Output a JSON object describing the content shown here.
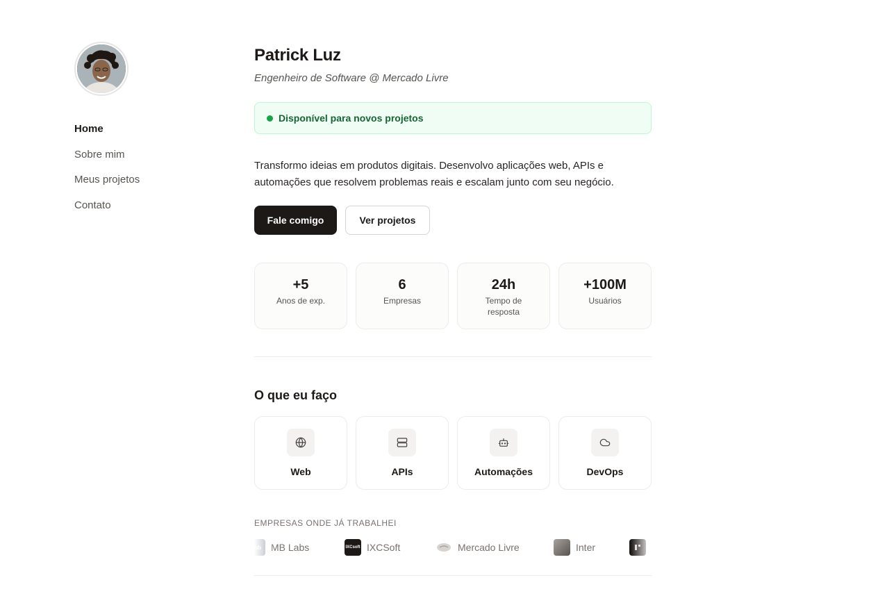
{
  "profile": {
    "name": "Patrick Luz",
    "role": "Engenheiro de Software @ Mercado Livre",
    "avatar_icon": "profile-photo"
  },
  "nav": {
    "items": [
      {
        "label": "Home",
        "active": true
      },
      {
        "label": "Sobre mim",
        "active": false
      },
      {
        "label": "Meus projetos",
        "active": false
      },
      {
        "label": "Contato",
        "active": false
      }
    ]
  },
  "availability": {
    "text": "Disponível para novos projetos",
    "color": "#16a34a"
  },
  "intro": "Transformo ideias em produtos digitais. Desenvolvo aplicações web, APIs e automações que resolvem problemas reais e escalam junto com seu negócio.",
  "buttons": {
    "primary": "Fale comigo",
    "secondary": "Ver projetos"
  },
  "stats": [
    {
      "value": "+5",
      "label": "Anos de exp."
    },
    {
      "value": "6",
      "label": "Empresas"
    },
    {
      "value": "24h",
      "label": "Tempo de resposta"
    },
    {
      "value": "+100M",
      "label": "Usuários"
    }
  ],
  "services": {
    "title": "O que eu faço",
    "items": [
      {
        "label": "Web",
        "icon": "globe-icon"
      },
      {
        "label": "APIs",
        "icon": "server-icon"
      },
      {
        "label": "Automações",
        "icon": "bot-icon"
      },
      {
        "label": "DevOps",
        "icon": "cloud-icon"
      }
    ]
  },
  "companies": {
    "title": "EMPRESAS ONDE JÁ TRABALHEI",
    "items": [
      {
        "name": "MB Labs",
        "logo_text": "mb"
      },
      {
        "name": "IXCSoft",
        "logo_text": "IXCsoft"
      },
      {
        "name": "Mercado Livre",
        "logo_text": ""
      },
      {
        "name": "Inter",
        "logo_text": ""
      },
      {
        "name": "",
        "logo_text": ""
      }
    ]
  },
  "colors": {
    "accent": "#1c1917",
    "success_bg": "#f0fdf4",
    "success_text": "#166534"
  }
}
